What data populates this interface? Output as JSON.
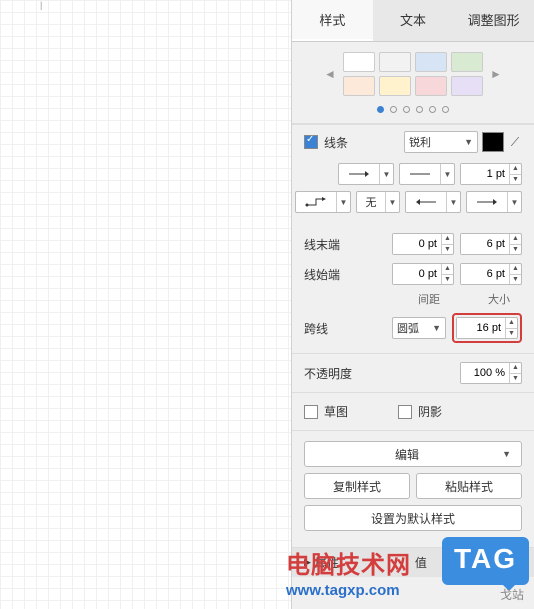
{
  "tabs": {
    "style": "样式",
    "text": "文本",
    "adjust": "调整图形"
  },
  "colors": {
    "row1": [
      "#ffffff",
      "#f2f2f2",
      "#d6e4f5",
      "#d9ead3"
    ],
    "row2": [
      "#fde9d9",
      "#fff2cc",
      "#f8d7da",
      "#e6dff5"
    ]
  },
  "line": {
    "checkbox_label": "线条",
    "sharp_label": "锐利",
    "weight_value": "1 pt",
    "style2_label": "无",
    "end_label": "线末端",
    "end_v1": "0 pt",
    "end_v2": "6 pt",
    "start_label": "线始端",
    "start_v1": "0 pt",
    "start_v2": "6 pt",
    "spacing_label": "间距",
    "size_label": "大小",
    "cross_label": "跨线",
    "arc_label": "圆弧",
    "size_value": "16 pt"
  },
  "opacity": {
    "label": "不透明度",
    "value": "100 %"
  },
  "checks": {
    "sketch": "草图",
    "shadow": "阴影"
  },
  "buttons": {
    "edit": "编辑",
    "copy": "复制样式",
    "paste": "粘贴样式",
    "setdefault": "设置为默认样式"
  },
  "props": {
    "attr": "属性",
    "value": "值"
  },
  "watermark": {
    "line1": "电脑技术网",
    "line2": "www.tagxp.com",
    "badge": "TAG",
    "under": "戈站"
  }
}
